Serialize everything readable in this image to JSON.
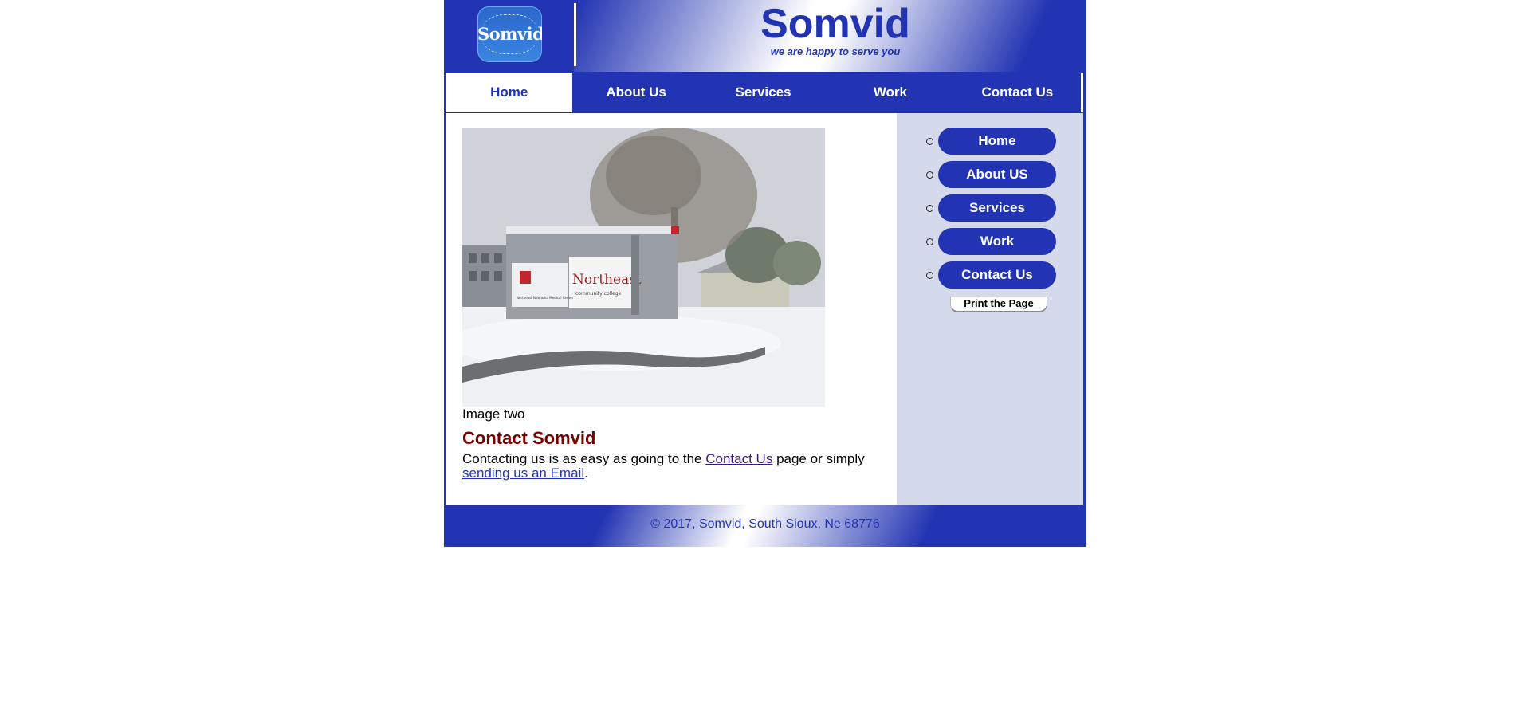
{
  "header": {
    "logo_text": "Somvid",
    "title": "Somvid",
    "tagline": "we are happy to serve you"
  },
  "nav": {
    "tabs": [
      {
        "label": "Home",
        "active": true
      },
      {
        "label": "About Us"
      },
      {
        "label": "Services"
      },
      {
        "label": "Work"
      },
      {
        "label": "Contact Us"
      }
    ]
  },
  "main": {
    "image_caption": "Image two",
    "sign_texts": [
      "Northeast",
      "community college",
      "Northeast Nebraska Medical Center"
    ],
    "heading": "Contact Somvid",
    "paragraph": {
      "before": "Contacting us is as easy as going to the ",
      "link1": "Contact Us",
      "middle": " page or simply ",
      "link2": "sending us an Email",
      "after": "."
    }
  },
  "sidebar": {
    "items": [
      "Home",
      "About US",
      "Services",
      "Work",
      "Contact Us"
    ],
    "print_label": "Print the Page"
  },
  "footer": {
    "text": "© 2017, Somvid, South Sioux, Ne 68776"
  },
  "colors": {
    "brand_blue": "#2234b3",
    "heading_red": "#7a0000",
    "sidebar_bg": "#d4d9ec"
  }
}
